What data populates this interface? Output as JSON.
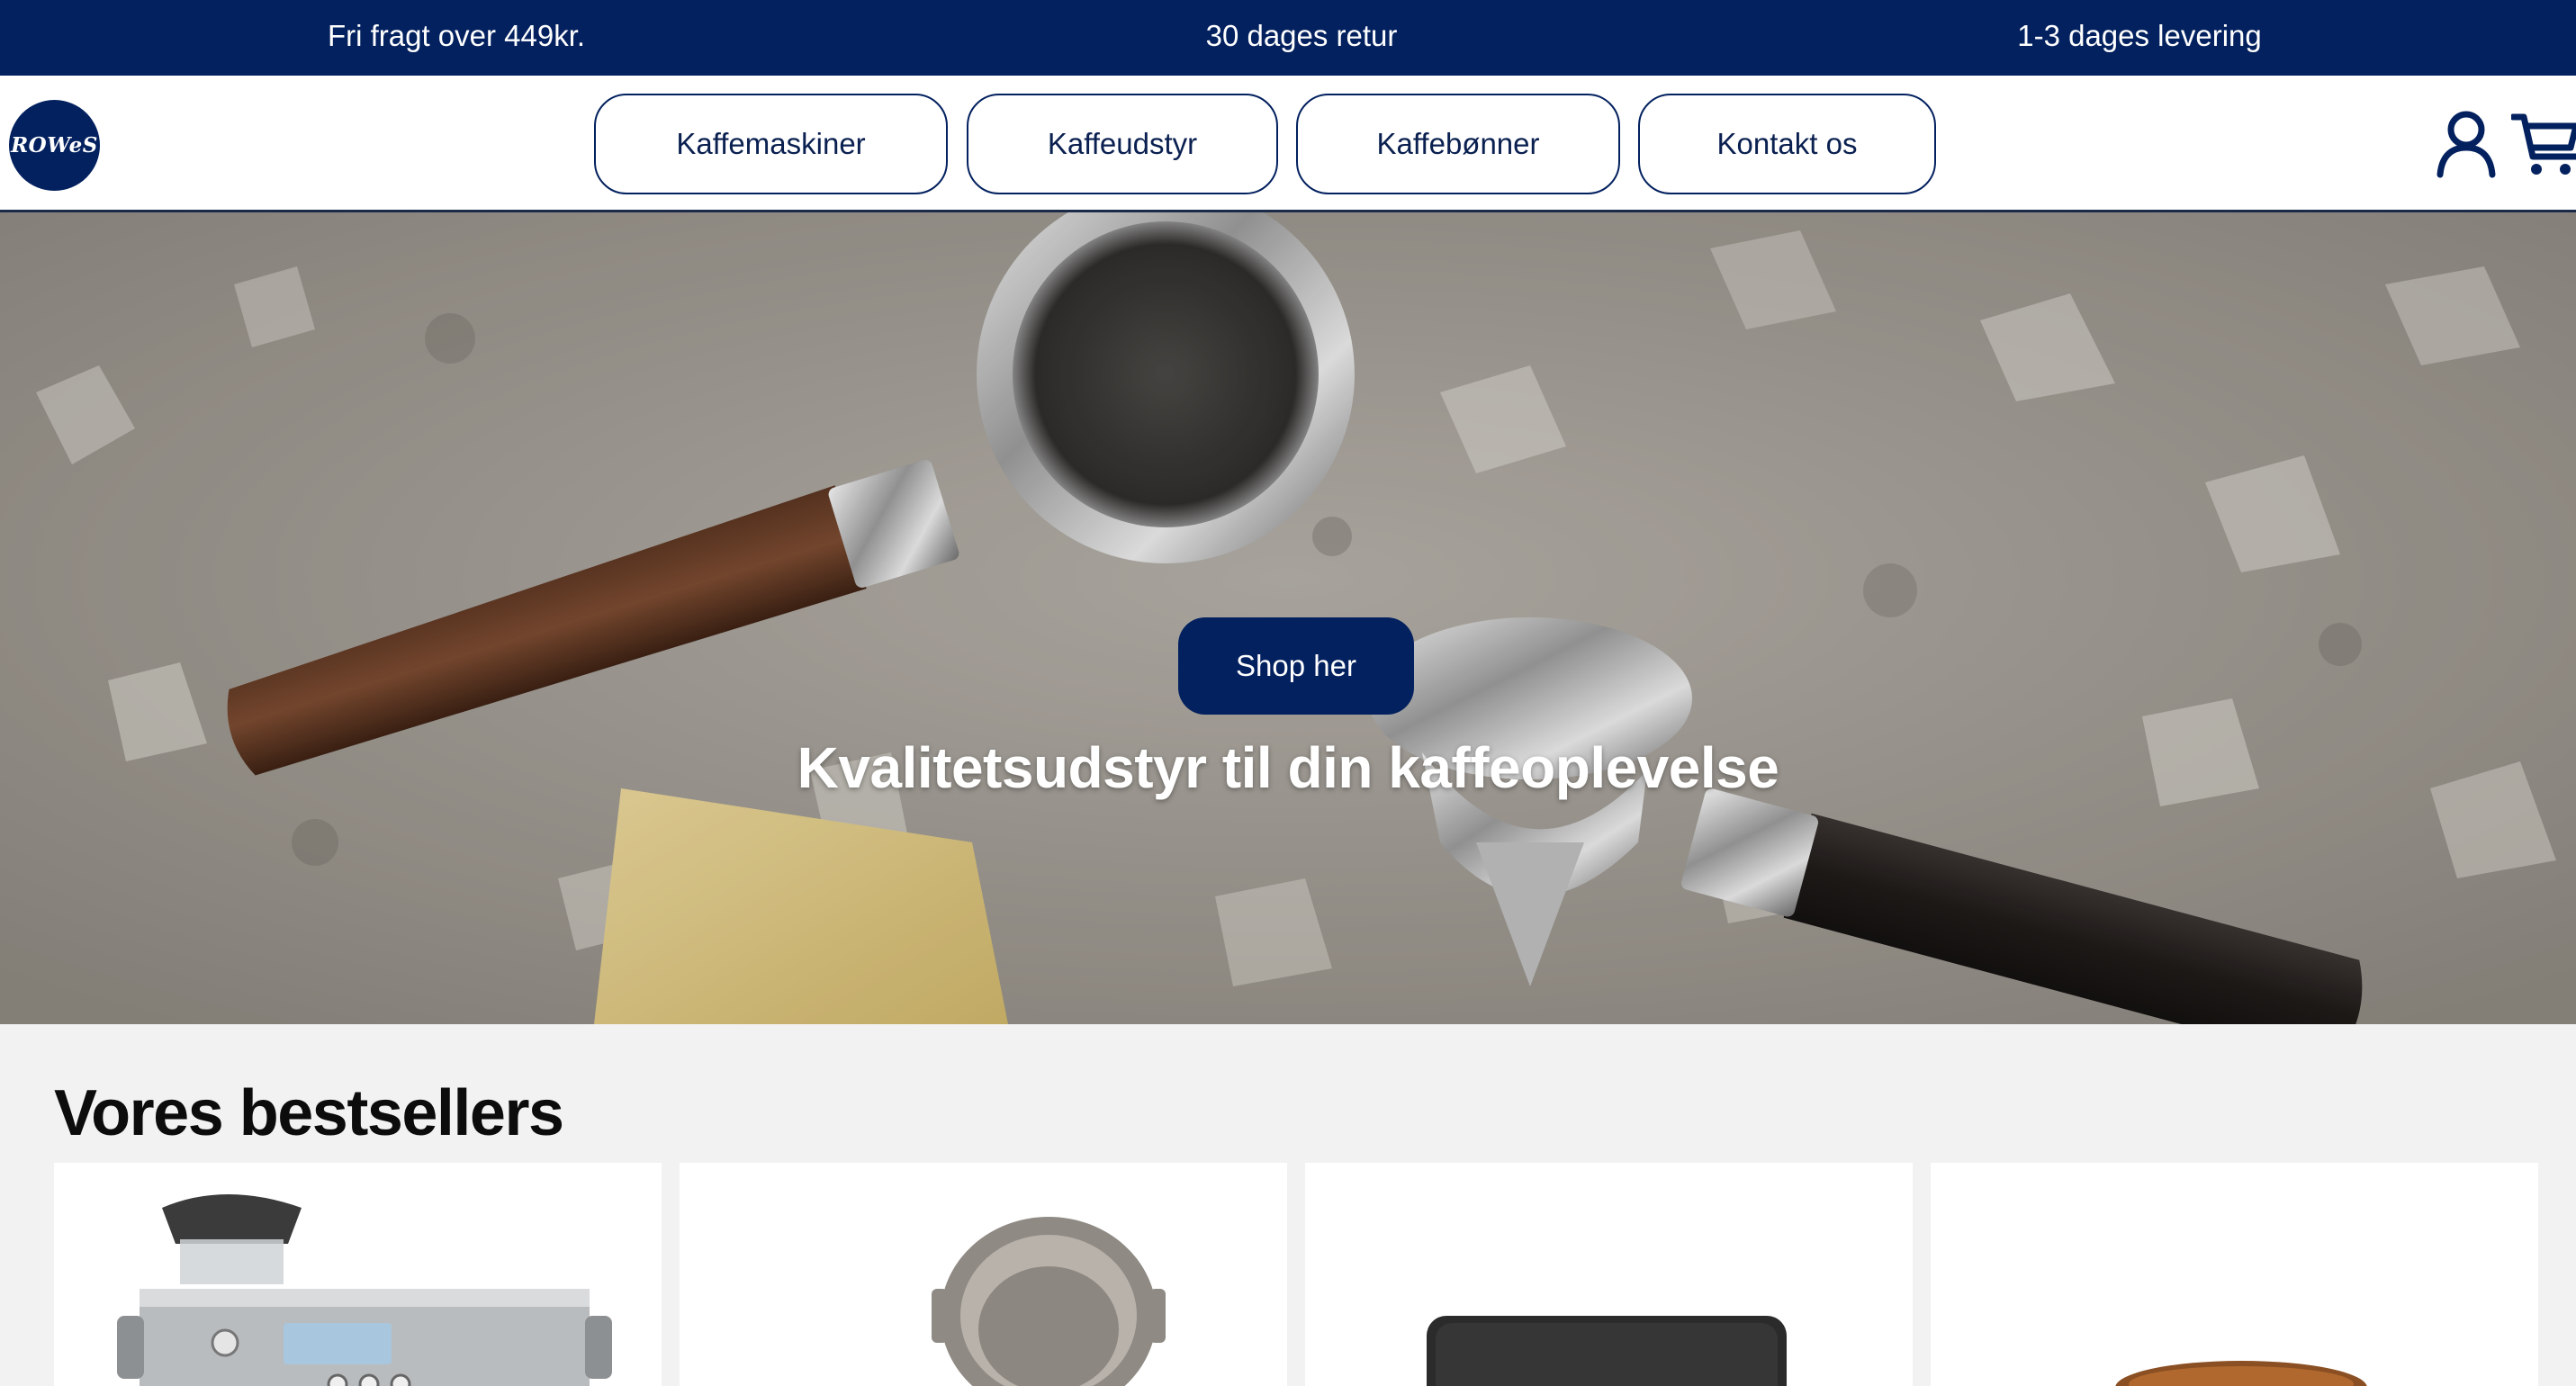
{
  "announcement_bar": {
    "items": [
      "Fri fragt over 449kr.",
      "30 dages retur",
      "1-3 dages levering"
    ]
  },
  "header": {
    "logo_text": "ROWeS",
    "nav": [
      "Kaffemaskiner",
      "Kaffeudstyr",
      "Kaffebønner",
      "Kontakt os"
    ],
    "icons": [
      "user-icon",
      "cart-icon"
    ]
  },
  "hero": {
    "title": "Kvalitetsudstyr til din kaffeoplevelse",
    "cta_label": "Shop her"
  },
  "bestsellers": {
    "title": "Vores bestsellers",
    "products": [
      {
        "image": "espresso-machine"
      },
      {
        "image": "portafilter-basket"
      },
      {
        "image": "tamping-mat"
      },
      {
        "image": "wooden-tamper"
      }
    ]
  },
  "colors": {
    "brand_navy": "#03215f",
    "page_background": "#f2f2f2",
    "card_background": "#ffffff"
  }
}
